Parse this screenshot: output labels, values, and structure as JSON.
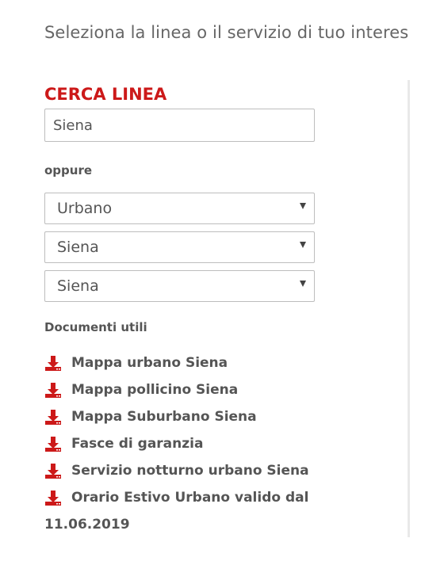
{
  "intro_text": "Seleziona la linea o il servizio di tuo interes",
  "search": {
    "heading": "CERCA LINEA",
    "value": "Siena"
  },
  "or_label": "oppure",
  "selects": [
    {
      "value": "Urbano"
    },
    {
      "value": "Siena"
    },
    {
      "value": "Siena"
    }
  ],
  "documents": {
    "heading": "Documenti utili",
    "items": [
      {
        "label": "Mappa urbano Siena",
        "icon": "download-icon"
      },
      {
        "label": "Mappa pollicino Siena",
        "icon": "download-icon"
      },
      {
        "label": "Mappa Suburbano Siena",
        "icon": "download-icon"
      },
      {
        "label": "Fasce di garanzia",
        "icon": "download-icon"
      },
      {
        "label": "Servizio notturno urbano Siena",
        "icon": "download-icon"
      },
      {
        "label": "Orario Estivo Urbano valido dal",
        "icon": "download-icon"
      }
    ],
    "last_item_continuation": "11.06.2019"
  },
  "colors": {
    "accent": "#cc1919",
    "text": "#555555"
  }
}
